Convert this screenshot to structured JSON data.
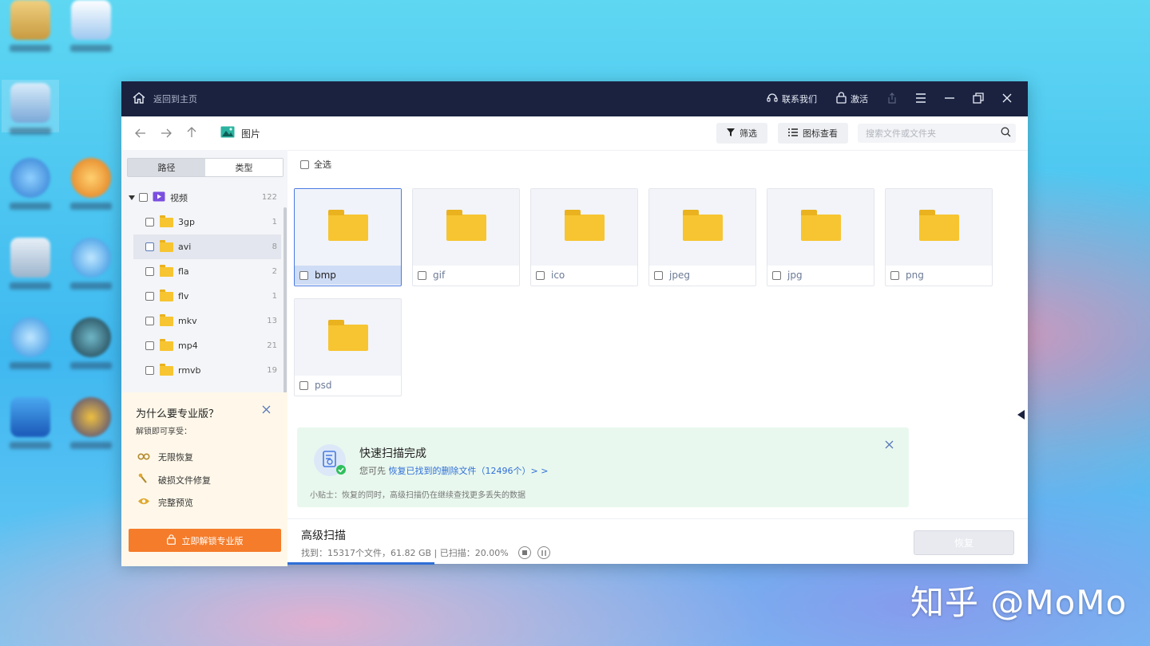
{
  "titlebar": {
    "home_label": "返回到主页",
    "contact_label": "联系我们",
    "activate_label": "激活"
  },
  "toolbar": {
    "breadcrumb": "图片",
    "filter_label": "筛选",
    "view_label": "图标查看",
    "search_placeholder": "搜索文件或文件夹"
  },
  "sidebar": {
    "tabs": [
      "路径",
      "类型"
    ],
    "active_tab": "类型",
    "root": {
      "label": "视频",
      "count": "122"
    },
    "items": [
      {
        "label": "3gp",
        "count": "1"
      },
      {
        "label": "avi",
        "count": "8"
      },
      {
        "label": "fla",
        "count": "2"
      },
      {
        "label": "flv",
        "count": "1"
      },
      {
        "label": "mkv",
        "count": "13"
      },
      {
        "label": "mp4",
        "count": "21"
      },
      {
        "label": "rmvb",
        "count": "19"
      }
    ],
    "selected_item": "avi"
  },
  "promo": {
    "title": "为什么要专业版？",
    "subtitle": "解锁即可享受：",
    "features": [
      "无限恢复",
      "破损文件修复",
      "完整预览"
    ],
    "unlock_label": "立即解锁专业版"
  },
  "main": {
    "select_all": "全选",
    "folders": [
      "bmp",
      "gif",
      "ico",
      "jpeg",
      "jpg",
      "png",
      "psd"
    ],
    "selected_folder": "bmp"
  },
  "scan_notice": {
    "title": "快速扫描完成",
    "prefix": "您可先",
    "link": "恢复已找到的删除文件（12496个）> >",
    "tip": "小贴士：恢复的同时，高级扫描仍在继续查找更多丢失的数据"
  },
  "status": {
    "title": "高级扫描",
    "detail": "找到：15317个文件，61.82 GB | 已扫描：20.00%",
    "progress": 0.2,
    "restore_label": "恢复"
  },
  "watermark": "知乎 @MoMo",
  "colors": {
    "titlebar": "#1a2240",
    "accent": "#2f6fd8",
    "folder": "#f7c531",
    "unlock": "#f57c2a",
    "scan_panel": "#e9f8ee"
  }
}
